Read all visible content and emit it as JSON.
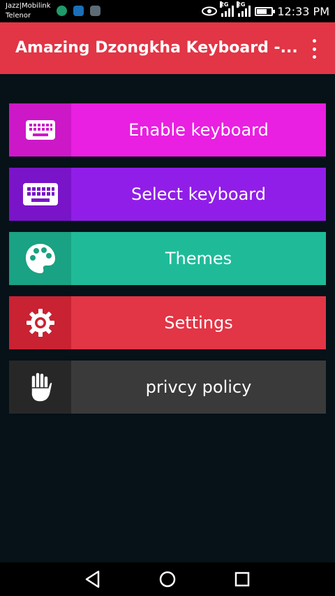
{
  "status_bar": {
    "carrier_1": "Jazz|Mobilink",
    "carrier_2": "Telenor",
    "network_1": "2G",
    "network_2": "2G",
    "time": "12:33 PM",
    "notification_icons": [
      "vpn-icon",
      "app-store-icon",
      "gallery-icon"
    ],
    "system_icons": [
      "eye-comfort-icon",
      "signal-icon",
      "battery-charging-icon"
    ]
  },
  "app_bar": {
    "title": "Amazing Dzongkha Keyboard -...",
    "overflow_icon": "more-vert-icon",
    "background": "#e23545"
  },
  "menu": [
    {
      "label": "Enable keyboard",
      "icon": "keyboard-icon",
      "color": "#e91fe1",
      "icon_bg": "#cc18c7"
    },
    {
      "label": "Select keyboard",
      "icon": "keyboard-icon",
      "color": "#911ee8",
      "icon_bg": "#7a14c8"
    },
    {
      "label": "Themes",
      "icon": "palette-icon",
      "color": "#1fbb99",
      "icon_bg": "#19a283"
    },
    {
      "label": "Settings",
      "icon": "gear-icon",
      "color": "#e23545",
      "icon_bg": "#c92232"
    },
    {
      "label": "privcy policy",
      "icon": "hand-icon",
      "color": "#3a3a3a",
      "icon_bg": "#272727"
    }
  ],
  "nav_bar": {
    "buttons": [
      "back-icon",
      "home-icon",
      "recents-icon"
    ]
  }
}
